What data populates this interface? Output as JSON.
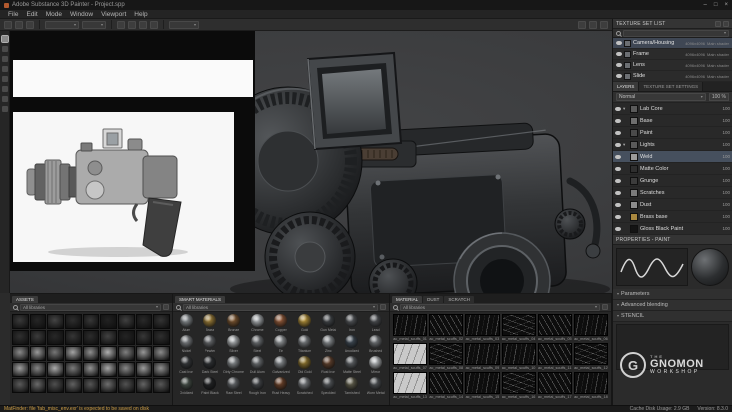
{
  "icons": {
    "caret": "▾"
  },
  "titlebar": {
    "app_title": "Adobe Substance 3D Painter - Project.spp",
    "minimize": "–",
    "maximize": "□",
    "close": "×"
  },
  "menubar": {
    "items": [
      "File",
      "Edit",
      "Mode",
      "Window",
      "Viewport",
      "Help"
    ]
  },
  "texture_set_list": {
    "title": "TEXTURE SET LIST",
    "rows": [
      {
        "name": "Camera/Housing",
        "res": "4096x4096",
        "shader": "Main shader",
        "selected": true
      },
      {
        "name": "Frame",
        "res": "4096x4096",
        "shader": "Main shader",
        "selected": false
      },
      {
        "name": "Lens",
        "res": "4096x4096",
        "shader": "Main shader",
        "selected": false
      },
      {
        "name": "Slide",
        "res": "4096x4096",
        "shader": "Main shader",
        "selected": false
      }
    ]
  },
  "layers_panel": {
    "tabs": [
      {
        "label": "LAYERS",
        "active": true
      },
      {
        "label": "TEXTURE SET SETTINGS",
        "active": false
      }
    ],
    "blend_mode": "Normal",
    "opacity": "100 %",
    "layers": [
      {
        "icon": "▾",
        "name": "Lab Core",
        "t": "#5a5a5a",
        "op": "100",
        "sel": false
      },
      {
        "icon": "",
        "name": "Base",
        "t": "#6e6e6e",
        "op": "100",
        "sel": false
      },
      {
        "icon": "",
        "name": "Paint",
        "t": "#4a4a4a",
        "op": "100",
        "sel": false
      },
      {
        "icon": "▾",
        "name": "Lights",
        "t": "#5a5a5a",
        "op": "100",
        "sel": false
      },
      {
        "icon": "",
        "name": "Weld",
        "t": "#9a9a9a",
        "op": "100",
        "sel": true
      },
      {
        "icon": "",
        "name": "Matte Color",
        "t": "#2f2f2f",
        "op": "100",
        "sel": false
      },
      {
        "icon": "",
        "name": "Grunge",
        "t": "#3c3c3c",
        "op": "100",
        "sel": false
      },
      {
        "icon": "",
        "name": "Scratches",
        "t": "#7a7a7a",
        "op": "100",
        "sel": false
      },
      {
        "icon": "",
        "name": "Dust",
        "t": "#8c8c8c",
        "op": "100",
        "sel": false
      },
      {
        "icon": "",
        "name": "Brass base",
        "t": "#a9883f",
        "op": "100",
        "sel": false
      },
      {
        "icon": "",
        "name": "Gloss Black Paint",
        "t": "#141414",
        "op": "100",
        "sel": false
      }
    ]
  },
  "properties": {
    "title": "PROPERTIES - PAINT",
    "groups": [
      {
        "label": "Parameters"
      },
      {
        "label": "Advanced blending"
      },
      {
        "label": "STENCIL"
      }
    ]
  },
  "assets_panel": {
    "title": "ASSETS",
    "filter": "All libraries",
    "thumbs": [
      "#3a3a3a",
      "#262626",
      "#444444",
      "#2e2e2e",
      "#383838",
      "#222222",
      "#404040",
      "#2a2a2a",
      "#343434",
      "#303030",
      "#3c3c3c",
      "#282828",
      "#363636",
      "#2c2c2c",
      "#424242",
      "#242424",
      "#383838",
      "#2f2f2f",
      "#8a8a8a",
      "#9a9a9a",
      "#777777",
      "#a5a5a5",
      "#8f8f8f",
      "#b0b0b0",
      "#808080",
      "#989898",
      "#8c8c8c",
      "#9f9f9f",
      "#858585",
      "#ababab",
      "#7a7a7a",
      "#939393",
      "#a8a8a8",
      "#888888",
      "#9d9d9d",
      "#909090",
      "#5a5a5a",
      "#6a6a6a",
      "#4f4f4f",
      "#616161",
      "#565656",
      "#6e6e6e",
      "#525252",
      "#646464",
      "#585858"
    ]
  },
  "smart_materials_panel": {
    "title": "SMART MATERIALS",
    "filter": "All libraries",
    "items": [
      {
        "n": "Alum",
        "c": "#9aa0a4"
      },
      {
        "n": "Brass",
        "c": "#b08d3f"
      },
      {
        "n": "Bronze",
        "c": "#8a5f35"
      },
      {
        "n": "Chrome",
        "c": "#c3c8cc"
      },
      {
        "n": "Copper",
        "c": "#a4643f"
      },
      {
        "n": "Gold",
        "c": "#c9a23f"
      },
      {
        "n": "Gun Metal",
        "c": "#4a4e52"
      },
      {
        "n": "Iron",
        "c": "#5c5f63"
      },
      {
        "n": "Lead",
        "c": "#55585c"
      },
      {
        "n": "Nickel",
        "c": "#8f9397"
      },
      {
        "n": "Pewter",
        "c": "#75787c"
      },
      {
        "n": "Silver",
        "c": "#c6cacd"
      },
      {
        "n": "Steel",
        "c": "#7e8286"
      },
      {
        "n": "Tin",
        "c": "#a7abae"
      },
      {
        "n": "Titanium",
        "c": "#8b8f93"
      },
      {
        "n": "Zinc",
        "c": "#9fa4a8"
      },
      {
        "n": "Anodized",
        "c": "#46525e"
      },
      {
        "n": "Brushed",
        "c": "#83878b"
      },
      {
        "n": "Cast Iron",
        "c": "#3d4043"
      },
      {
        "n": "Dark Steel",
        "c": "#34373a"
      },
      {
        "n": "Dirty Chrome",
        "c": "#9ba0a3"
      },
      {
        "n": "Dull Alum",
        "c": "#7d8184"
      },
      {
        "n": "Galvanized",
        "c": "#989da1"
      },
      {
        "n": "Old Gold",
        "c": "#a08434"
      },
      {
        "n": "Rust Iron",
        "c": "#6e4a33"
      },
      {
        "n": "Matte Steel",
        "c": "#6a6e72"
      },
      {
        "n": "Mirror",
        "c": "#d2d6d9"
      },
      {
        "n": "Oxidized",
        "c": "#4f5a52"
      },
      {
        "n": "Paint Black",
        "c": "#26282a"
      },
      {
        "n": "Raw Steel",
        "c": "#73777b"
      },
      {
        "n": "Rough Iron",
        "c": "#4c4f53"
      },
      {
        "n": "Rust Heavy",
        "c": "#7a4a2e"
      },
      {
        "n": "Scratched",
        "c": "#888c90"
      },
      {
        "n": "Speckled",
        "c": "#5f6367"
      },
      {
        "n": "Tarnished",
        "c": "#6d6a55"
      },
      {
        "n": "Worn Metal",
        "c": "#595d61"
      }
    ]
  },
  "grunge_panel": {
    "tabs": [
      {
        "label": "MATERIAL",
        "active": true
      },
      {
        "label": "DUST",
        "active": false
      },
      {
        "label": "SCRATCH",
        "active": false
      }
    ],
    "filter": "All libraries",
    "items": [
      {
        "n": "ac_metal_scuffs_01"
      },
      {
        "n": "ac_metal_scuffs_02"
      },
      {
        "n": "ac_metal_scuffs_03"
      },
      {
        "n": "ac_metal_scuffs_04"
      },
      {
        "n": "ac_metal_scuffs_05"
      },
      {
        "n": "ac_metal_scuffs_06"
      },
      {
        "n": "ac_metal_scuffs_07"
      },
      {
        "n": "ac_metal_scuffs_08"
      },
      {
        "n": "ac_metal_scuffs_09"
      },
      {
        "n": "ac_metal_scuffs_10"
      },
      {
        "n": "ac_metal_scuffs_11"
      },
      {
        "n": "ac_metal_scuffs_12"
      },
      {
        "n": "ac_metal_scuffs_13"
      },
      {
        "n": "ac_metal_scuffs_14"
      },
      {
        "n": "ac_metal_scuffs_15"
      },
      {
        "n": "ac_metal_scuffs_16"
      },
      {
        "n": "ac_metal_scuffs_17"
      },
      {
        "n": "ac_metal_scuffs_18"
      }
    ]
  },
  "statusbar": {
    "message": "MatFinder: file 'fab_misc_env.exr' is expected to be saved on disk",
    "disk_usage": "Cache Disk Usage: 2.9 GB",
    "version": "Version: 8.3.0"
  },
  "watermark": {
    "logo_letter": "G",
    "line1": "THE",
    "line2": "GNOMON",
    "line3": "WORKSHOP"
  }
}
